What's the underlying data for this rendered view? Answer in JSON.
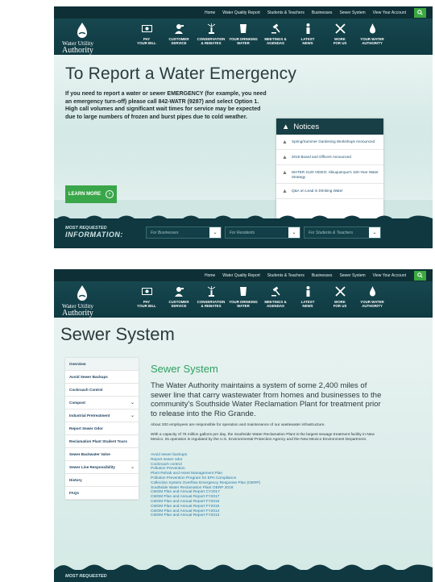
{
  "topbar": {
    "links": [
      "Home",
      "Water Quality Report",
      "Students & Teachers",
      "Businesses",
      "Sewer System",
      "View Your Account"
    ]
  },
  "logo": {
    "line1": "Water Utility",
    "line2": "Authority"
  },
  "nav": [
    {
      "label": "Pay\nYour Bill",
      "icon": "money-icon"
    },
    {
      "label": "Customer\nService",
      "icon": "customer-service-icon"
    },
    {
      "label": "Conservation\n& Rebates",
      "icon": "sprinkler-icon"
    },
    {
      "label": "Your Drinking\nWater",
      "icon": "glass-icon"
    },
    {
      "label": "Meetings &\nAgendas",
      "icon": "gavel-icon"
    },
    {
      "label": "Latest\nNews",
      "icon": "news-icon"
    },
    {
      "label": "Work\nFor Us",
      "icon": "tools-icon"
    },
    {
      "label": "Your Water\nAuthority",
      "icon": "drop-icon"
    }
  ],
  "hero": {
    "title": "To Report a Water Emergency",
    "text": "If you need to report a water or sewer EMERGENCY (for example, you need an emergency turn-off) please call 842-WATR (9287) and select Option 1. High call volumes and significant wait times for service may be expected due to large numbers of frozen and burst pipes due to cold weather.",
    "button": "LEARN MORE"
  },
  "notices": {
    "title": "Notices",
    "items": [
      "Spring/Summer Gardening Workshops Announced",
      "2019 Board and Officers Announced",
      "WATER 2120 VIDEO: Albuquerque's 100-Year Water Strategy",
      "Q&A on Lead in Drinking Water"
    ]
  },
  "most_requested": {
    "line1": "MOST REQUESTED",
    "line2": "INFORMATION:",
    "selects": [
      "For Businesses",
      "For Residents",
      "For Students & Teachers"
    ]
  },
  "sewer": {
    "page_title": "Sewer System",
    "side_items": [
      {
        "label": "Overview",
        "chev": ""
      },
      {
        "label": "Avoid Sewer Backups",
        "chev": ""
      },
      {
        "label": "Cockroach Control",
        "chev": ""
      },
      {
        "label": "Compost",
        "chev": "⌄"
      },
      {
        "label": "Industrial Pretreatment",
        "chev": "⌄"
      },
      {
        "label": "Report Sewer Odor",
        "chev": ""
      },
      {
        "label": "Reclamation Plant Student Tours",
        "chev": ""
      },
      {
        "label": "Sewer Backwater Valve",
        "chev": ""
      },
      {
        "label": "Sewer Line Responsibility",
        "chev": "⌄"
      },
      {
        "label": "History",
        "chev": ""
      },
      {
        "label": "FAQs",
        "chev": ""
      }
    ],
    "heading": "Sewer System",
    "lead": "The Water Authority maintains a system of some 2,400 miles of sewer line that carry wastewater from homes and businesses to the community's Southside Water Reclamation Plant for treatment prior to release into the Rio Grande.",
    "para1": "About 200 employees are responsible for operation and maintenance of our wastewater infrastructure.",
    "para2": "With a capacity of 76 million gallons per day, the Southside Water Reclamation Plant is the largest sewage treatment facility in New Mexico. Its operation is regulated by the U.S. Environmental Protection Agency and the New Mexico Environment Department.",
    "links": [
      "Avoid sewer backups",
      "Report sewer odor",
      "Cockroach control",
      "Pollution Prevention",
      "Plant Rehab and Asset Management Plan",
      "Pollution Prevention Program for EPA Compliance",
      "Collection System Overflow Emergency Response Plan (OERP)",
      "Southside Water Reclamation Plant OERP 2018",
      "CMOM Plan and Annual Report CY2017",
      "CMOM Plan and Annual Report FY2017",
      "CMOM Plan and Annual Report FY2016",
      "CMOM Plan and Annual Report FY2015",
      "CMOM Plan and Annual Report FY2014",
      "CMOM Plan and Annual Report FY2013"
    ],
    "footer_label": "MOST REQUESTED"
  }
}
